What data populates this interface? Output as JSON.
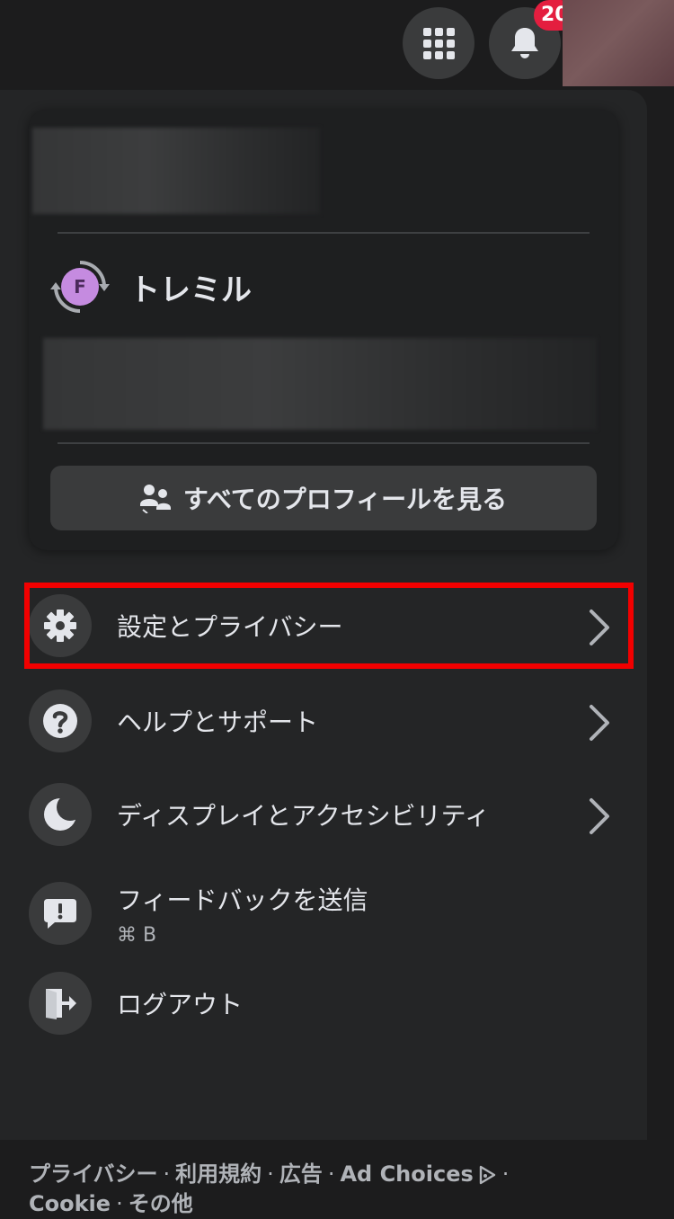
{
  "topbar": {
    "notification_count": "20"
  },
  "profile_card": {
    "page_name": "トレミル",
    "page_avatar_letter": "F",
    "all_profiles_label": "すべてのプロフィールを見る"
  },
  "menu": {
    "settings": "設定とプライバシー",
    "help": "ヘルプとサポート",
    "display": "ディスプレイとアクセシビリティ",
    "feedback": "フィードバックを送信",
    "feedback_shortcut": "⌘ B",
    "logout": "ログアウト"
  },
  "footer": {
    "privacy": "プライバシー",
    "terms": "利用規約",
    "ads": "広告",
    "ad_choices": "Ad Choices",
    "cookie": "Cookie",
    "more": "その他",
    "separator": "·"
  },
  "icons": {
    "menu": "grid-menu-icon",
    "notifications": "bell-icon",
    "settings": "gear-icon",
    "help": "question-icon",
    "display": "moon-icon",
    "feedback": "feedback-icon",
    "logout": "logout-icon",
    "chevron": "chevron-right-icon"
  },
  "colors": {
    "background": "#1c1c1d",
    "panel": "#242526",
    "badge": "#e41e3f",
    "highlight": "#f20000",
    "text": "#e4e6eb",
    "secondary_text": "#b0b3b8"
  }
}
